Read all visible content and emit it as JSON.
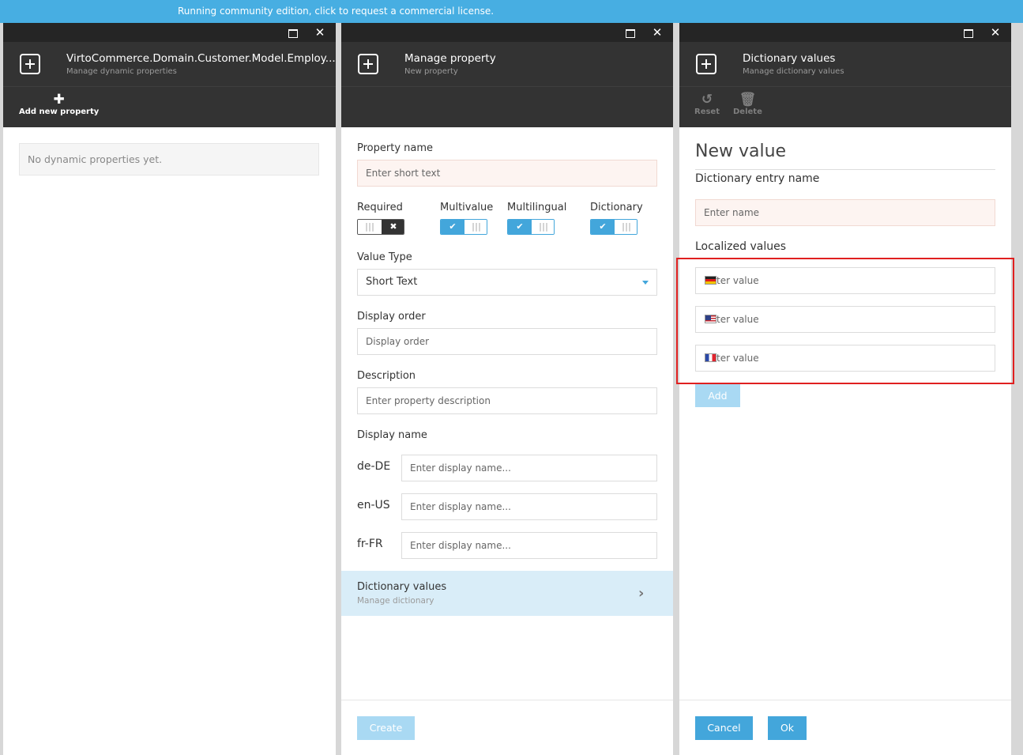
{
  "banner": {
    "text": "Running community edition, click to request a commercial license."
  },
  "blades": [
    {
      "title": "VirtoCommerce.Domain.Customer.Model.Employ...",
      "subtitle": "Manage dynamic properties",
      "toolbar": [
        {
          "label": "Add new property",
          "icon": "plus-icon"
        }
      ],
      "empty_text": "No dynamic properties yet."
    },
    {
      "title": "Manage property",
      "subtitle": "New property",
      "property_name_label": "Property name",
      "property_name_placeholder": "Enter short text",
      "toggles": [
        {
          "label": "Required",
          "on": false
        },
        {
          "label": "Multivalue",
          "on": true
        },
        {
          "label": "Multilingual",
          "on": true
        },
        {
          "label": "Dictionary",
          "on": true
        }
      ],
      "value_type_label": "Value Type",
      "value_type_selected": "Short Text",
      "display_order_label": "Display order",
      "display_order_placeholder": "Display order",
      "description_label": "Description",
      "description_placeholder": "Enter property description",
      "display_name_label": "Display name",
      "display_names": [
        {
          "lang": "de-DE",
          "placeholder": "Enter display name..."
        },
        {
          "lang": "en-US",
          "placeholder": "Enter display name..."
        },
        {
          "lang": "fr-FR",
          "placeholder": "Enter display name..."
        }
      ],
      "dictionary_nav": {
        "title": "Dictionary values",
        "subtitle": "Manage dictionary"
      },
      "create_label": "Create"
    },
    {
      "title": "Dictionary values",
      "subtitle": "Manage dictionary values",
      "toolbar": [
        {
          "label": "Reset",
          "icon": "undo-icon",
          "enabled": false
        },
        {
          "label": "Delete",
          "icon": "trash-icon",
          "enabled": false
        }
      ],
      "heading": "New value",
      "entry_name_label": "Dictionary entry name",
      "entry_name_placeholder": "Enter name",
      "localized_label": "Localized values",
      "localized": [
        {
          "flag": "de-flag-icon",
          "text": "ter value"
        },
        {
          "flag": "us-flag-icon",
          "text": "ter value"
        },
        {
          "flag": "fr-flag-icon",
          "text": "ter value"
        }
      ],
      "add_label": "Add",
      "cancel_label": "Cancel",
      "ok_label": "Ok"
    }
  ],
  "colors": {
    "accent": "#43a6db",
    "header": "#333333",
    "banner": "#47aee2",
    "highlight": "#e02020"
  }
}
